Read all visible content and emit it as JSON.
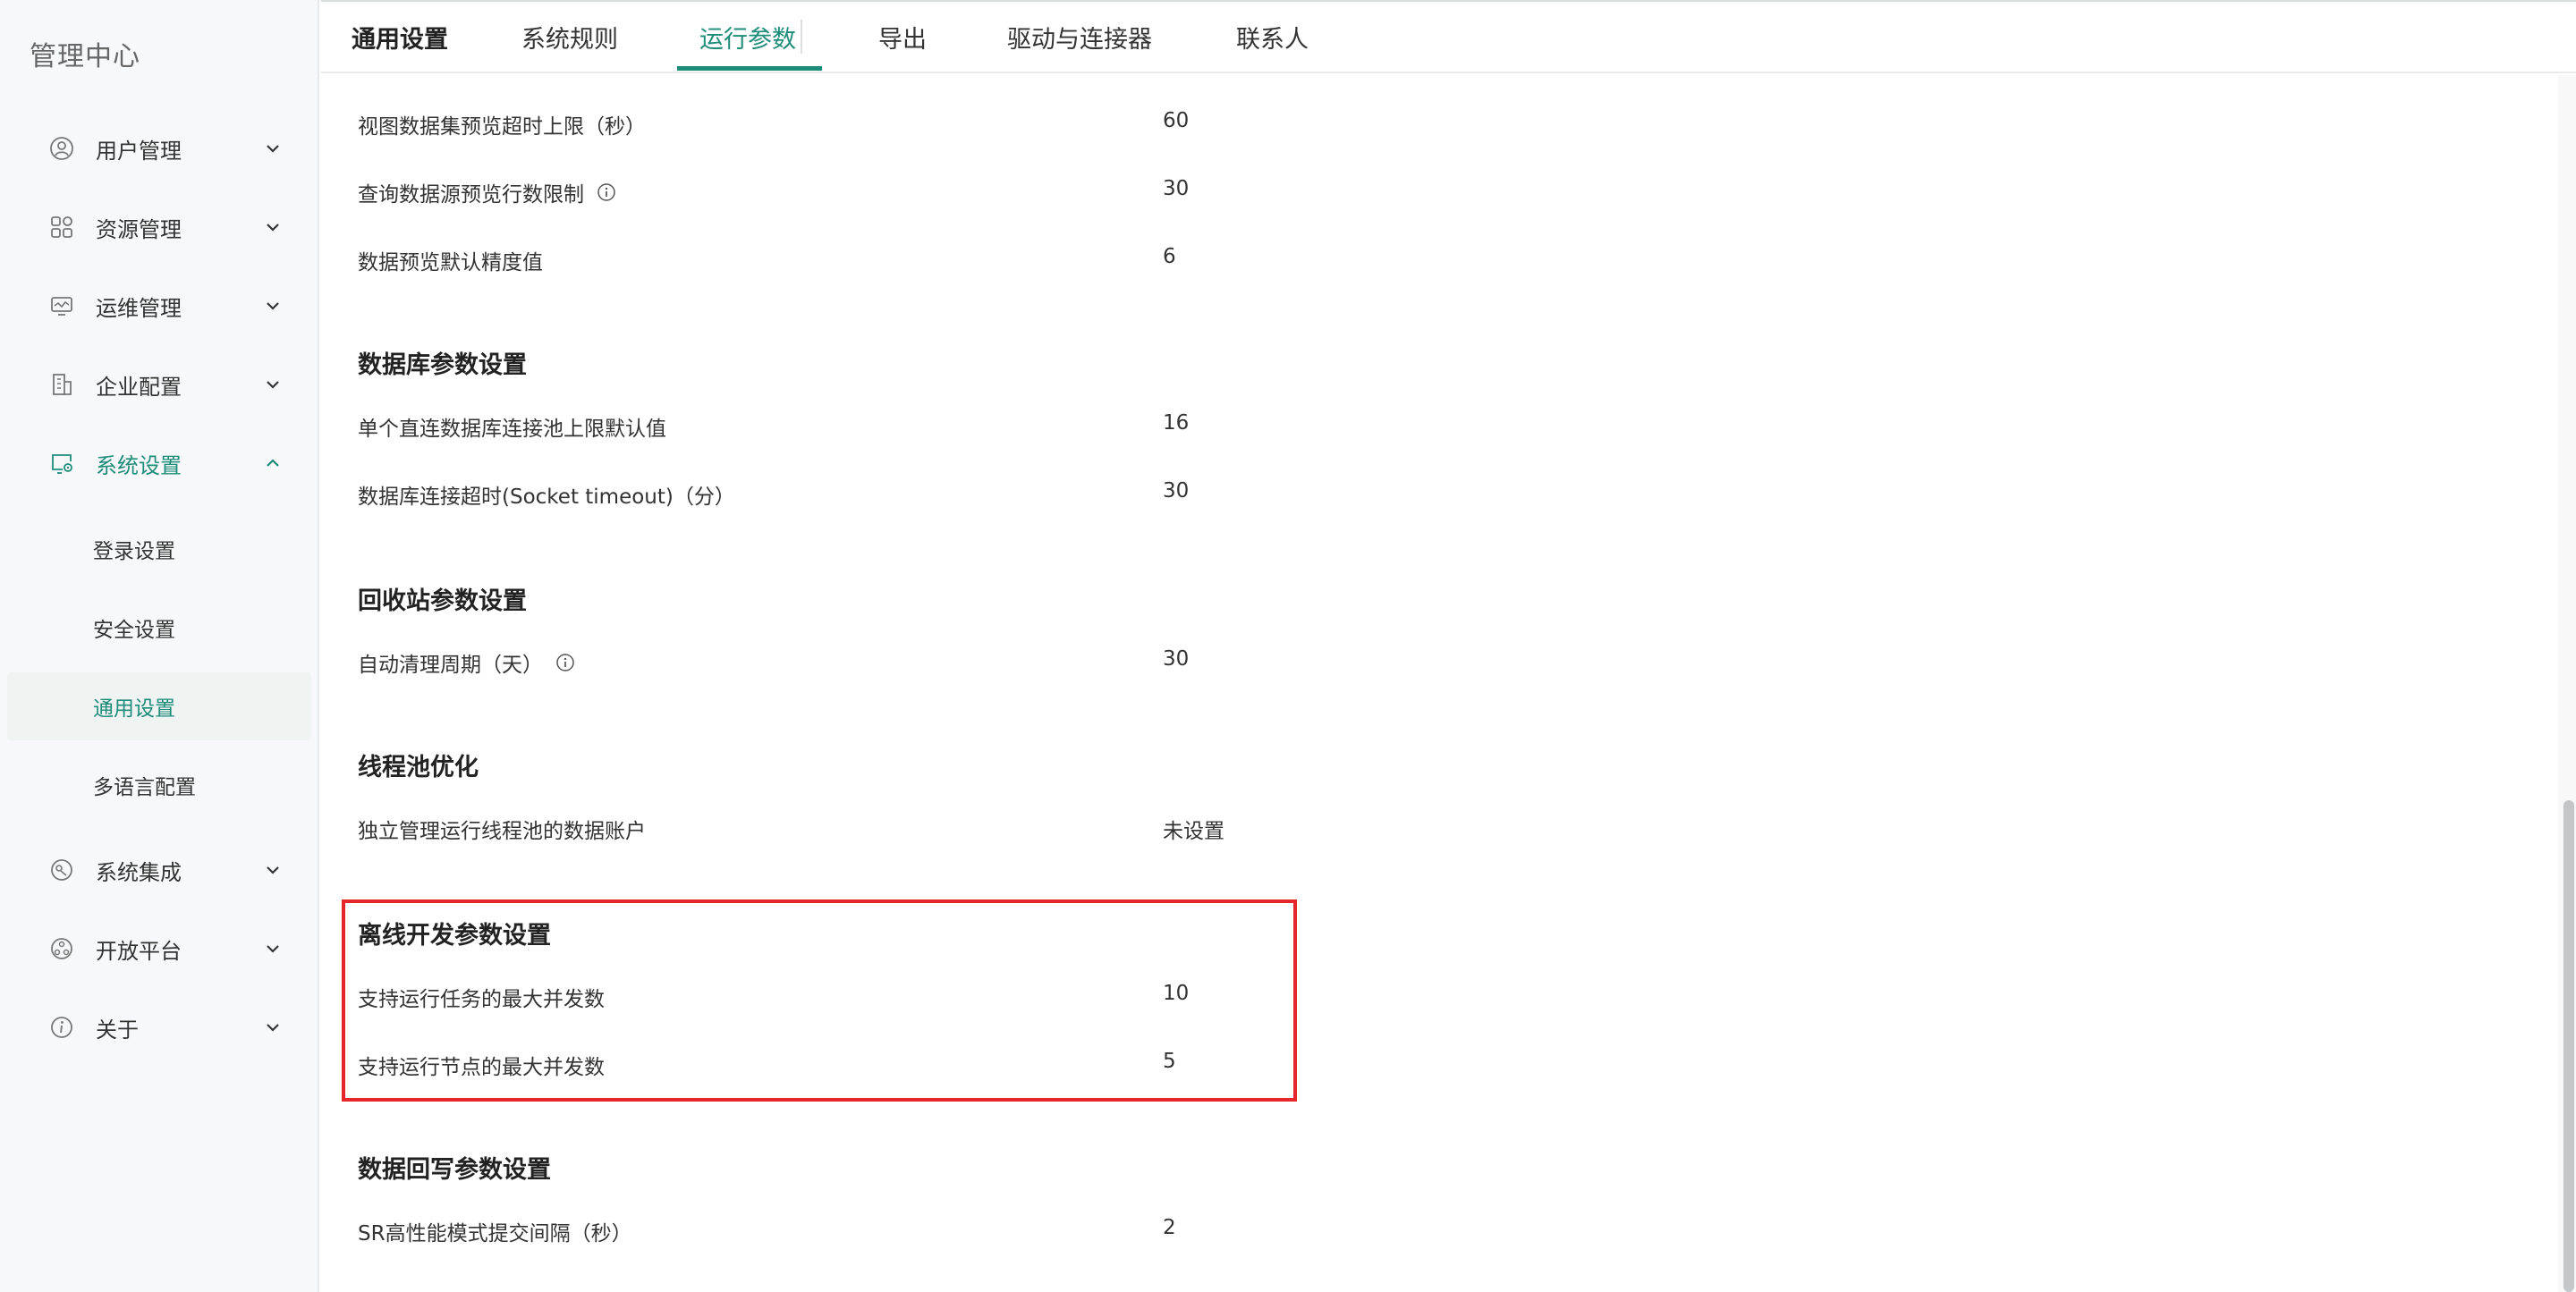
{
  "sidebar": {
    "title": "管理中心",
    "items": [
      {
        "label": "用户管理",
        "icon": "user-icon"
      },
      {
        "label": "资源管理",
        "icon": "grid-icon"
      },
      {
        "label": "运维管理",
        "icon": "monitor-icon"
      },
      {
        "label": "企业配置",
        "icon": "building-icon"
      },
      {
        "label": "系统设置",
        "icon": "settings-monitor-icon"
      },
      {
        "label": "系统集成",
        "icon": "integration-icon"
      },
      {
        "label": "开放平台",
        "icon": "open-platform-icon"
      },
      {
        "label": "关于",
        "icon": "info-icon"
      }
    ],
    "sub_items": [
      {
        "label": "登录设置"
      },
      {
        "label": "安全设置"
      },
      {
        "label": "通用设置"
      },
      {
        "label": "多语言配置"
      }
    ],
    "accent_color": "#1d8c79"
  },
  "tabs": {
    "section_title": "通用设置",
    "items": [
      {
        "label": "系统规则"
      },
      {
        "label": "运行参数"
      },
      {
        "label": "导出"
      },
      {
        "label": "驱动与连接器"
      },
      {
        "label": "联系人"
      }
    ],
    "active": "运行参数"
  },
  "content": {
    "preview": [
      {
        "label": "视图数据集预览超时上限（秒）",
        "value": "60"
      },
      {
        "label": "查询数据源预览行数限制",
        "value": "30"
      },
      {
        "label": "数据预览默认精度值",
        "value": "6"
      }
    ],
    "database": {
      "title": "数据库参数设置",
      "rows": [
        {
          "label": "单个直连数据库连接池上限默认值",
          "value": "16"
        },
        {
          "label": "数据库连接超时(Socket timeout)（分）",
          "value": "30"
        }
      ]
    },
    "recycle": {
      "title": "回收站参数设置",
      "rows": [
        {
          "label": "自动清理周期（天）",
          "value": "30"
        }
      ]
    },
    "threadpool": {
      "title": "线程池优化",
      "rows": [
        {
          "label": "独立管理运行线程池的数据账户",
          "value": "未设置"
        }
      ]
    },
    "offline": {
      "title": "离线开发参数设置",
      "rows": [
        {
          "label": "支持运行任务的最大并发数",
          "value": "10"
        },
        {
          "label": "支持运行节点的最大并发数",
          "value": "5"
        }
      ]
    },
    "writeback": {
      "title": "数据回写参数设置",
      "rows": [
        {
          "label": "SR高性能模式提交间隔（秒）",
          "value": "2"
        }
      ]
    }
  },
  "highlight_color": "#e6262b"
}
